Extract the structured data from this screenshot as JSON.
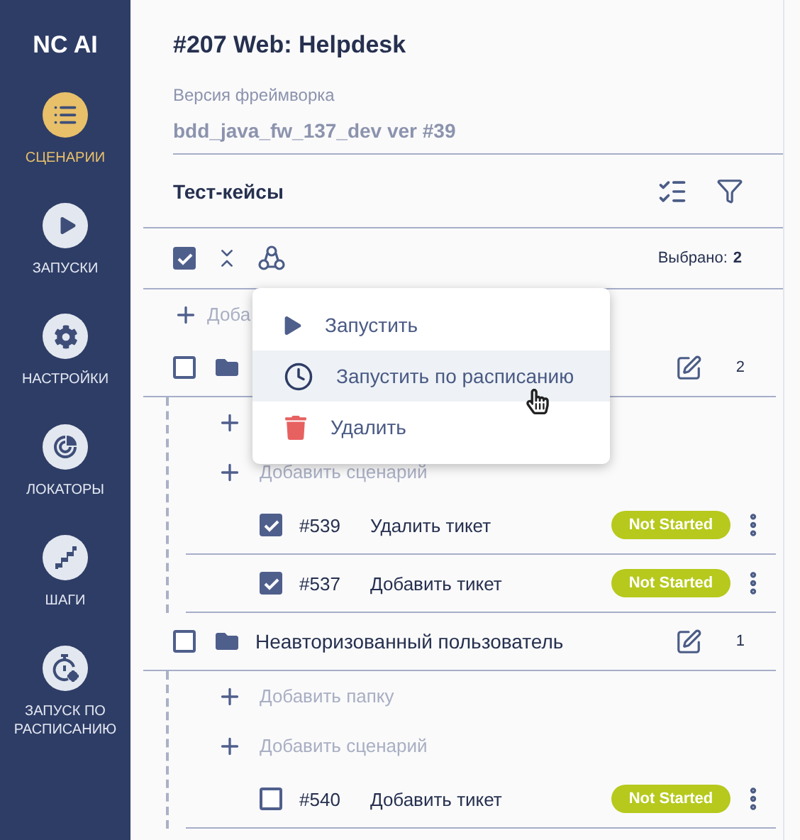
{
  "sidebar": {
    "logo": "NC AI",
    "items": [
      {
        "kind": "list",
        "label": "СЦЕНАРИИ",
        "selected": true
      },
      {
        "kind": "play",
        "label": "ЗАПУСКИ",
        "selected": false
      },
      {
        "kind": "gear",
        "label": "НАСТРОЙКИ",
        "selected": false
      },
      {
        "kind": "radar",
        "label": "ЛОКАТОРЫ",
        "selected": false
      },
      {
        "kind": "stairs",
        "label": "ШАГИ",
        "selected": false
      },
      {
        "kind": "timer",
        "label": "ЗАПУСК ПО РАСПИСАНИЮ",
        "selected": false
      }
    ]
  },
  "project": {
    "title": "#207 Web: Helpdesk",
    "framework_label": "Версия фреймворка",
    "framework_value": "bdd_java_fw_137_dev ver #39"
  },
  "test_cases": {
    "title": "Тест-кейсы",
    "all_checked": true,
    "selected_label": "Выбрано:",
    "selected_count": "2",
    "tree": [
      {
        "kind": "add",
        "label": "Доба"
      },
      {
        "kind": "folder",
        "checked": false,
        "count": "2",
        "children": [
          {
            "kind": "add"
          },
          {
            "kind": "add",
            "label": "Добавить сценарий"
          },
          {
            "kind": "case",
            "checked": true,
            "number": "#539",
            "title": "Удалить тикет",
            "status": "Not Started"
          },
          {
            "kind": "case",
            "checked": true,
            "number": "#537",
            "title": "Добавить тикет",
            "status": "Not Started"
          }
        ]
      },
      {
        "kind": "folder",
        "name": "Неавторизованный пользователь",
        "checked": false,
        "count": "1",
        "children": [
          {
            "kind": "add",
            "label": "Добавить папку"
          },
          {
            "kind": "add",
            "label": "Добавить сценарий"
          },
          {
            "kind": "case",
            "checked": false,
            "number": "#540",
            "title": "Добавить тикет",
            "status": "Not Started"
          }
        ]
      }
    ]
  },
  "context_menu": {
    "items": [
      {
        "kind": "run",
        "label": "Запустить",
        "selected": false
      },
      {
        "kind": "schedule",
        "label": "Запустить по расписанию",
        "selected": true
      },
      {
        "kind": "delete",
        "label": "Удалить",
        "selected": false
      }
    ]
  }
}
